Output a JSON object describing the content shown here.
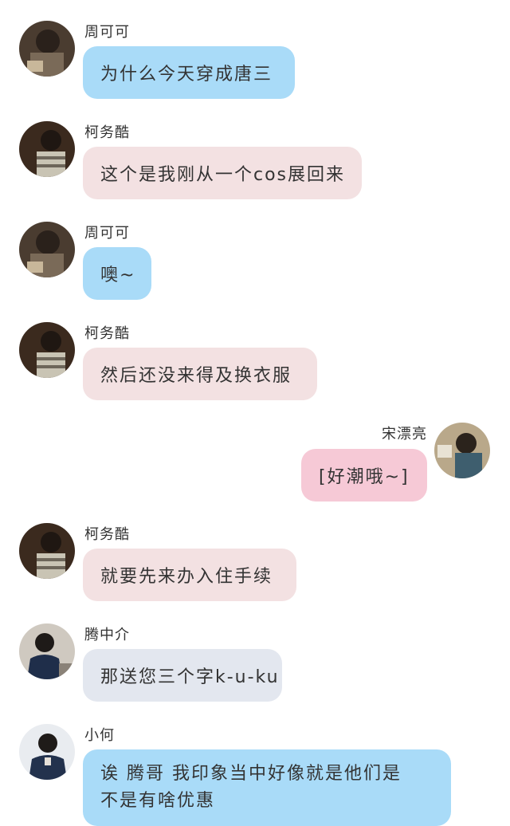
{
  "messages": [
    {
      "sender": "周可可",
      "text": "为什么今天穿成唐三",
      "avatar": "avatar-zhou-kk",
      "bubble_color": "#a9dbf8"
    },
    {
      "sender": "柯务酷",
      "text": "这个是我刚从一个cos展回来",
      "avatar": "avatar-ke-wu-ku",
      "bubble_color": "#f3e1e2"
    },
    {
      "sender": "周可可",
      "text": "噢~",
      "avatar": "avatar-zhou-kk",
      "bubble_color": "#a9dbf8"
    },
    {
      "sender": "柯务酷",
      "text": "然后还没来得及换衣服",
      "avatar": "avatar-ke-wu-ku",
      "bubble_color": "#f3e1e2"
    },
    {
      "sender": "宋漂亮",
      "text": "[好潮哦~]",
      "avatar": "avatar-song-pl",
      "bubble_color": "#f6c9d6"
    },
    {
      "sender": "柯务酷",
      "text": "就要先来办入住手续",
      "avatar": "avatar-ke-wu-ku",
      "bubble_color": "#f3e1e2"
    },
    {
      "sender": "腾中介",
      "text": "那送您三个字k-u-ku",
      "avatar": "avatar-teng-zj",
      "bubble_color": "#e3e7ef"
    },
    {
      "sender": "小何",
      "text_line1": "诶 腾哥 我印象当中好像就是他们是",
      "text_line2": "不是有啥优惠",
      "avatar": "avatar-xiao-he",
      "bubble_color": "#a9dbf8"
    }
  ]
}
